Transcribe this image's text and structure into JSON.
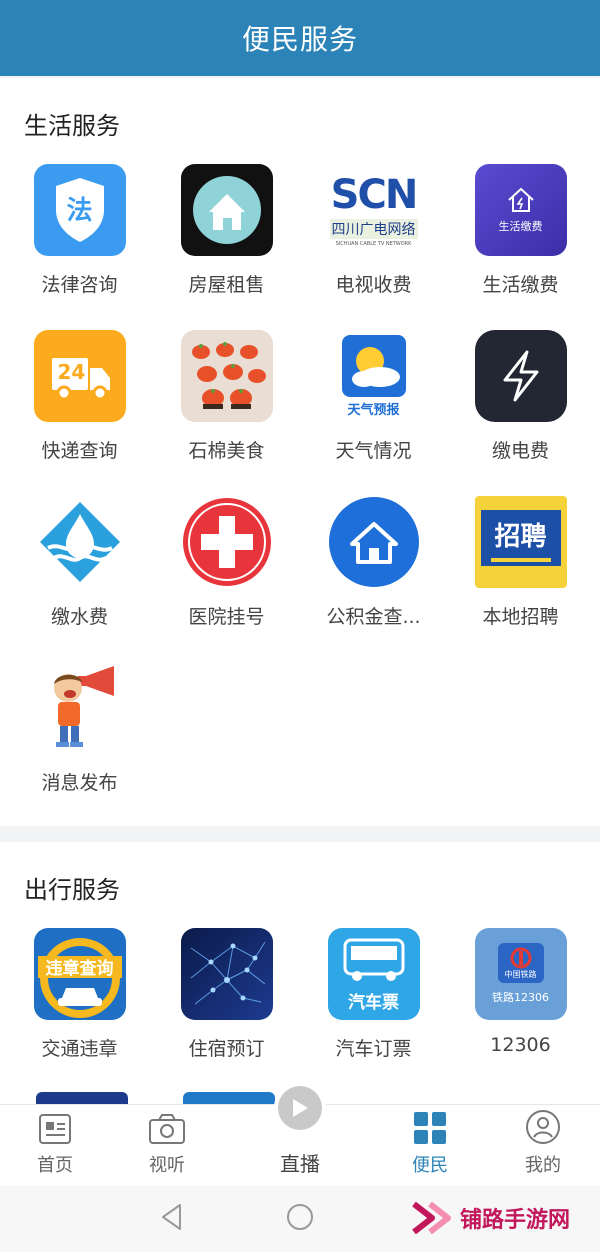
{
  "header": {
    "title": "便民服务"
  },
  "sections": [
    {
      "title": "生活服务",
      "items": [
        {
          "label": "法律咨询",
          "icon": "law-shield-icon",
          "badge": "法"
        },
        {
          "label": "房屋租售",
          "icon": "house-icon"
        },
        {
          "label": "电视收费",
          "icon": "scn-tv-logo-icon",
          "logo_text": "SCN",
          "logo_sub": "四川广电网络",
          "logo_sub2": "SICHUAN CABLE TV NETWORK"
        },
        {
          "label": "生活缴费",
          "icon": "life-payment-icon",
          "inner_text": "生活缴费"
        },
        {
          "label": "快递查询",
          "icon": "delivery-truck-icon",
          "badge": "24"
        },
        {
          "label": "石棉美食",
          "icon": "food-photo-icon"
        },
        {
          "label": "天气情况",
          "icon": "weather-icon",
          "caption": "天气预报"
        },
        {
          "label": "缴电费",
          "icon": "lightning-icon"
        },
        {
          "label": "缴水费",
          "icon": "water-drop-icon"
        },
        {
          "label": "医院挂号",
          "icon": "red-cross-icon"
        },
        {
          "label": "公积金查...",
          "icon": "housing-fund-icon"
        },
        {
          "label": "本地招聘",
          "icon": "recruit-icon",
          "badge": "招聘"
        },
        {
          "label": "消息发布",
          "icon": "megaphone-boy-icon"
        }
      ]
    },
    {
      "title": "出行服务",
      "items": [
        {
          "label": "交通违章",
          "icon": "traffic-violation-icon",
          "badge": "违章查询"
        },
        {
          "label": "住宿预订",
          "icon": "hotel-network-icon"
        },
        {
          "label": "汽车订票",
          "icon": "bus-icon",
          "caption": "汽车票"
        },
        {
          "label": "12306",
          "icon": "railway-icon",
          "inner_text": "中国铁路",
          "caption": "铁路12306"
        }
      ]
    }
  ],
  "tabbar": [
    {
      "label": "首页",
      "icon": "home-news-icon",
      "active": false
    },
    {
      "label": "视听",
      "icon": "camera-icon",
      "active": false
    },
    {
      "label": "直播",
      "icon": "play-icon",
      "active": false
    },
    {
      "label": "便民",
      "icon": "grid-icon",
      "active": true
    },
    {
      "label": "我的",
      "icon": "user-icon",
      "active": false
    }
  ],
  "watermark": {
    "text": "铺路手游网"
  },
  "colors": {
    "primary": "#2b83b8",
    "background": "#f2f3f5",
    "watermark": "#c2185b"
  }
}
